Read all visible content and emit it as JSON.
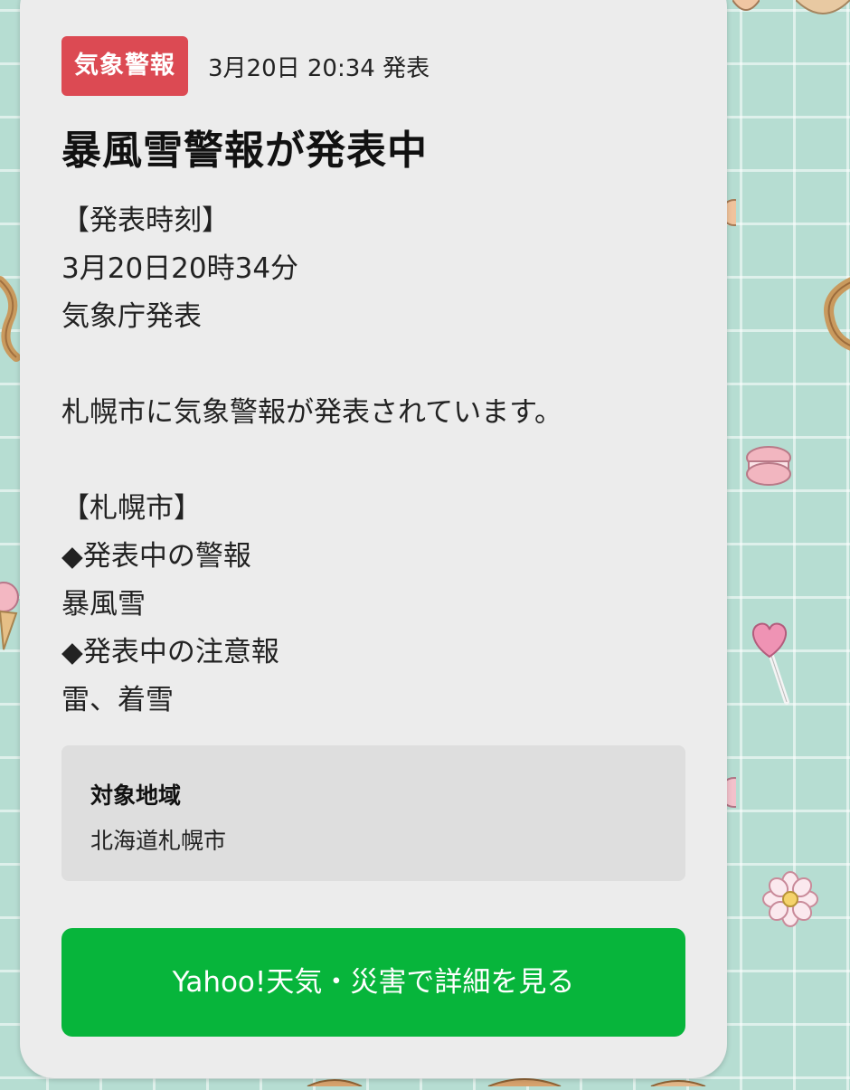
{
  "notification": {
    "category_badge": "気象警報",
    "issued_time": "3月20日 20:34 発表",
    "title": "暴風雪警報が発表中",
    "body_lines": [
      "【発表時刻】",
      "3月20日20時34分",
      "気象庁発表",
      "",
      "札幌市に気象警報が発表されています。",
      "",
      "【札幌市】",
      "◆発表中の警報",
      "暴風雪",
      "◆発表中の注意報",
      "雷、着雪"
    ],
    "region": {
      "label": "対象地域",
      "value": "北海道札幌市"
    },
    "cta_label": "Yahoo!天気・災害で詳細を見る"
  },
  "colors": {
    "badge": "#dc4a53",
    "cta": "#07b53b",
    "card": "#ececec",
    "wallpaper": "#b6ddd2"
  },
  "wallpaper": {
    "stickers": [
      "macaron-icon",
      "lollipop-icon",
      "flower-icon",
      "pretzel-icon"
    ]
  }
}
